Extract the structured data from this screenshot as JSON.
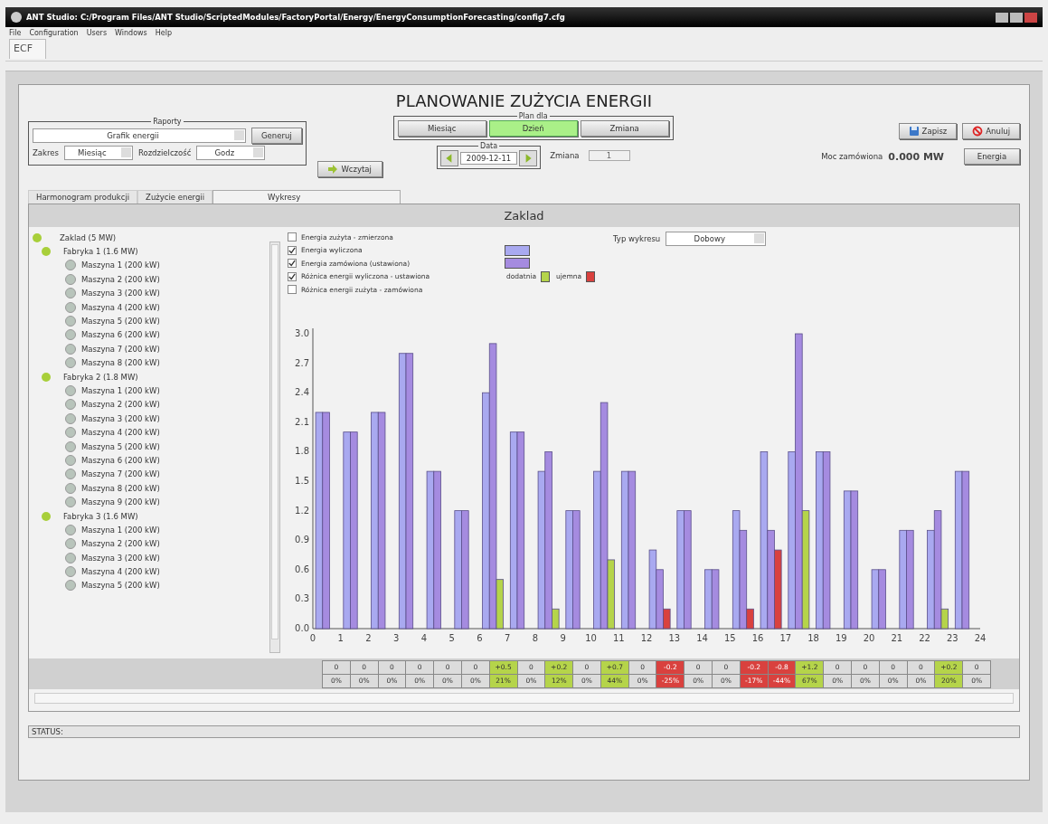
{
  "window": {
    "title": "ANT Studio: C:/Program Files/ANT Studio/ScriptedModules/FactoryPortal/Energy/EnergyConsumptionForecasting/config7.cfg"
  },
  "menu": [
    "File",
    "Configuration",
    "Users",
    "Windows",
    "Help"
  ],
  "doc_tab": "ECF",
  "page_title": "PLANOWANIE ZUŻYCIA ENERGII",
  "reports": {
    "legend": "Raporty",
    "report": "Grafik energii",
    "generate": "Generuj",
    "range_label": "Zakres",
    "range": "Miesiąc",
    "resolution_label": "Rozdzielczość",
    "resolution": "Godz"
  },
  "load_button": "Wczytaj",
  "plan_for": {
    "legend": "Plan dla",
    "options": [
      {
        "label": "Miesiąc",
        "selected": false
      },
      {
        "label": "Dzień",
        "selected": true
      },
      {
        "label": "Zmiana",
        "selected": false
      }
    ]
  },
  "date": {
    "legend": "Data",
    "value": "2009-12-11"
  },
  "shift": {
    "label": "Zmiana",
    "value": "1",
    "disabled": true
  },
  "save_button": "Zapisz",
  "cancel_button": "Anuluj",
  "ordered_power": {
    "label": "Moc zamówiona",
    "value": "0.000 MW"
  },
  "energy_button": "Energia",
  "tabs": [
    {
      "label": "Harmonogram produkcji",
      "selected": false
    },
    {
      "label": "Zużycie energii",
      "selected": false
    },
    {
      "label": "Wykresy",
      "selected": true
    }
  ],
  "panel_title": "Zaklad",
  "tree": {
    "label": "Zaklad (5 MW)",
    "children": [
      {
        "label": "Fabryka 1 (1.6 MW)",
        "children": [
          {
            "label": "Maszyna 1 (200 kW)"
          },
          {
            "label": "Maszyna 2 (200 kW)"
          },
          {
            "label": "Maszyna 3 (200 kW)"
          },
          {
            "label": "Maszyna 4 (200 kW)"
          },
          {
            "label": "Maszyna 5 (200 kW)"
          },
          {
            "label": "Maszyna 6 (200 kW)"
          },
          {
            "label": "Maszyna 7 (200 kW)"
          },
          {
            "label": "Maszyna 8 (200 kW)"
          }
        ]
      },
      {
        "label": "Fabryka 2 (1.8 MW)",
        "children": [
          {
            "label": "Maszyna 1 (200 kW)"
          },
          {
            "label": "Maszyna 2 (200 kW)"
          },
          {
            "label": "Maszyna 3 (200 kW)"
          },
          {
            "label": "Maszyna 4 (200 kW)"
          },
          {
            "label": "Maszyna 5 (200 kW)"
          },
          {
            "label": "Maszyna 6 (200 kW)"
          },
          {
            "label": "Maszyna 7 (200 kW)"
          },
          {
            "label": "Maszyna 8 (200 kW)"
          },
          {
            "label": "Maszyna 9 (200 kW)"
          }
        ]
      },
      {
        "label": "Fabryka 3 (1.6 MW)",
        "children": [
          {
            "label": "Maszyna 1 (200 kW)"
          },
          {
            "label": "Maszyna 2 (200 kW)"
          },
          {
            "label": "Maszyna 3 (200 kW)"
          },
          {
            "label": "Maszyna 4 (200 kW)"
          },
          {
            "label": "Maszyna 5 (200 kW)"
          }
        ]
      }
    ]
  },
  "series_options": [
    {
      "label": "Energia zużyta - zmierzona",
      "checked": false
    },
    {
      "label": "Energia wyliczona",
      "checked": true,
      "swatches": [
        {
          "color": "#a9a9f0"
        }
      ]
    },
    {
      "label": "Energia zamówiona (ustawiona)",
      "checked": true,
      "swatches": [
        {
          "color": "#a58be0"
        }
      ]
    },
    {
      "label": "Różnica energii wyliczona - ustawiona",
      "checked": true,
      "swatches": [
        {
          "label": "dodatnia",
          "color": "#b5d44a"
        },
        {
          "label": "ujemna",
          "color": "#d9413e"
        }
      ]
    },
    {
      "label": "Różnica energii zużyta - zamówiona",
      "checked": false
    }
  ],
  "chart_type": {
    "label": "Typ wykresu",
    "value": "Dobowy"
  },
  "chart_data": {
    "type": "bar",
    "x": [
      0.5,
      1.5,
      2.5,
      3.5,
      4.5,
      5.5,
      6.5,
      7.5,
      8.5,
      9.5,
      10.5,
      11.5,
      12.5,
      13.5,
      14.5,
      15.5,
      16.5,
      17.5,
      18.5,
      19.5,
      20.5,
      21.5,
      22.5,
      23.5
    ],
    "xlim": [
      0,
      24
    ],
    "series": [
      {
        "color": "#a9a9f0",
        "values": [
          2.2,
          2.0,
          2.2,
          2.8,
          1.6,
          1.2,
          2.4,
          2.0,
          1.6,
          1.2,
          1.6,
          1.6,
          0.8,
          1.2,
          0.6,
          1.2,
          1.8,
          1.8,
          1.8,
          1.4,
          0.6,
          1.0,
          1.0,
          1.6
        ]
      },
      {
        "color": "#a58be0",
        "values": [
          2.2,
          2.0,
          2.2,
          2.8,
          1.6,
          1.2,
          2.9,
          2.0,
          1.8,
          1.2,
          2.3,
          1.6,
          0.6,
          1.2,
          0.6,
          1.0,
          1.0,
          3.0,
          1.8,
          1.4,
          0.6,
          1.0,
          1.2,
          1.6
        ]
      },
      {
        "color": "#b5d44a",
        "values": [
          null,
          null,
          null,
          null,
          null,
          null,
          0.5,
          null,
          0.2,
          null,
          0.7,
          null,
          null,
          null,
          null,
          null,
          null,
          1.2,
          null,
          null,
          null,
          null,
          0.2,
          null
        ]
      },
      {
        "color": "#d9413e",
        "values": [
          null,
          null,
          null,
          null,
          null,
          null,
          null,
          null,
          null,
          null,
          null,
          null,
          0.2,
          null,
          null,
          0.2,
          0.8,
          null,
          null,
          null,
          null,
          null,
          null,
          null
        ]
      }
    ],
    "ylim": [
      0,
      3.0
    ],
    "yticks": [
      {
        "value": 0,
        "label": "0.0"
      },
      {
        "value": 0.3,
        "label": "0.3"
      },
      {
        "value": 0.6,
        "label": "0.6"
      },
      {
        "value": 0.9,
        "label": "0.9"
      },
      {
        "value": 1.2,
        "label": "1.2"
      },
      {
        "value": 1.5,
        "label": "1.5"
      },
      {
        "value": 1.8,
        "label": "1.8"
      },
      {
        "value": 2.1,
        "label": "2.1"
      },
      {
        "value": 2.4,
        "label": "2.4"
      },
      {
        "value": 2.7,
        "label": "2.7"
      },
      {
        "value": 3,
        "label": "3.0"
      }
    ],
    "xticks": [
      0,
      1,
      2,
      3,
      4,
      5,
      6,
      7,
      8,
      9,
      10,
      11,
      12,
      13,
      14,
      15,
      16,
      17,
      18,
      19,
      20,
      21,
      22,
      23,
      24
    ]
  },
  "diff_table": [
    {
      "kind": "zero",
      "value": "0",
      "percent": "0%"
    },
    {
      "kind": "zero",
      "value": "0",
      "percent": "0%"
    },
    {
      "kind": "zero",
      "value": "0",
      "percent": "0%"
    },
    {
      "kind": "zero",
      "value": "0",
      "percent": "0%"
    },
    {
      "kind": "zero",
      "value": "0",
      "percent": "0%"
    },
    {
      "kind": "zero",
      "value": "0",
      "percent": "0%"
    },
    {
      "kind": "positive",
      "value": "+0.5",
      "percent": "21%"
    },
    {
      "kind": "zero",
      "value": "0",
      "percent": "0%"
    },
    {
      "kind": "positive",
      "value": "+0.2",
      "percent": "12%"
    },
    {
      "kind": "zero",
      "value": "0",
      "percent": "0%"
    },
    {
      "kind": "positive",
      "value": "+0.7",
      "percent": "44%"
    },
    {
      "kind": "zero",
      "value": "0",
      "percent": "0%"
    },
    {
      "kind": "negative",
      "value": "-0.2",
      "percent": "-25%"
    },
    {
      "kind": "zero",
      "value": "0",
      "percent": "0%"
    },
    {
      "kind": "zero",
      "value": "0",
      "percent": "0%"
    },
    {
      "kind": "negative",
      "value": "-0.2",
      "percent": "-17%"
    },
    {
      "kind": "negative",
      "value": "-0.8",
      "percent": "-44%"
    },
    {
      "kind": "positive",
      "value": "+1.2",
      "percent": "67%"
    },
    {
      "kind": "zero",
      "value": "0",
      "percent": "0%"
    },
    {
      "kind": "zero",
      "value": "0",
      "percent": "0%"
    },
    {
      "kind": "zero",
      "value": "0",
      "percent": "0%"
    },
    {
      "kind": "zero",
      "value": "0",
      "percent": "0%"
    },
    {
      "kind": "positive",
      "value": "+0.2",
      "percent": "20%"
    },
    {
      "kind": "zero",
      "value": "0",
      "percent": "0%"
    }
  ],
  "status_bar": "STATUS:"
}
